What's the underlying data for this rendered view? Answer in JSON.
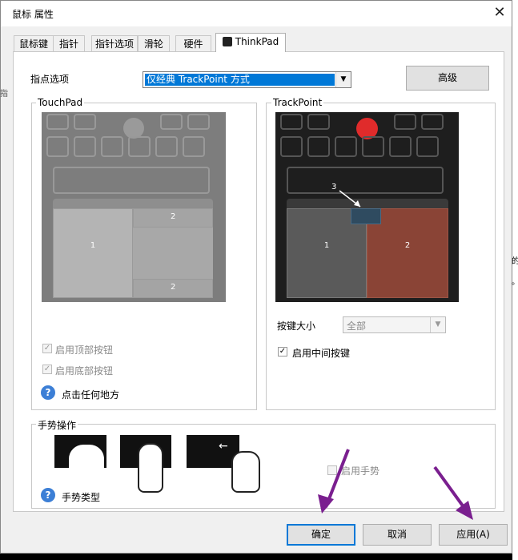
{
  "window": {
    "title": "鼠标 属性",
    "close": "✕"
  },
  "tabs": [
    {
      "label": "鼠标键"
    },
    {
      "label": "指针"
    },
    {
      "label": "指针选项"
    },
    {
      "label": "滑轮"
    },
    {
      "label": "硬件"
    },
    {
      "label": "ThinkPad",
      "active": true
    }
  ],
  "pointing": {
    "label": "指点选项",
    "selected": "仅经典 TrackPoint 方式",
    "advanced_button": "高级"
  },
  "touchpad": {
    "title": "TouchPad",
    "zone1": "1",
    "zone2_top": "2",
    "zone2_bottom": "2",
    "enable_top_buttons": "启用顶部按钮",
    "enable_bottom_buttons": "启用底部按钮",
    "click_anywhere": "点击任何地方"
  },
  "trackpoint": {
    "title": "TrackPoint",
    "zone1": "1",
    "zone2": "2",
    "zone3": "3",
    "button_size_label": "按键大小",
    "button_size_value": "全部",
    "enable_middle_button": "启用中间按键"
  },
  "gestures": {
    "title": "手势操作",
    "enable_gestures": "启用手势",
    "gesture_types": "手势类型"
  },
  "footer": {
    "ok": "确定",
    "cancel": "取消",
    "apply": "应用(A)"
  },
  "colors": {
    "trackpoint_nub": "#e02b2b",
    "right_zone": "#8a4436",
    "selection": "#0078d7",
    "annotation_arrow": "#7a1f8f"
  },
  "background_fragments": {
    "top_left": "36",
    "left_text": "指",
    "right_text_1": "的",
    "right_text_2": "。"
  }
}
